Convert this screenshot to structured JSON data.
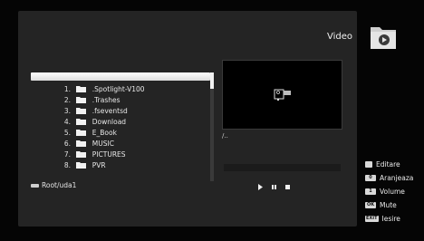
{
  "header": {
    "title": "Video",
    "icon": "video-folder-icon"
  },
  "file_list": {
    "items": [
      {
        "num": "1.",
        "name": ".Spotlight-V100"
      },
      {
        "num": "2.",
        "name": ".Trashes"
      },
      {
        "num": "3.",
        "name": ".fseventsd"
      },
      {
        "num": "4.",
        "name": "Download"
      },
      {
        "num": "5.",
        "name": "E_Book"
      },
      {
        "num": "6.",
        "name": "MUSIC"
      },
      {
        "num": "7.",
        "name": "PICTURES"
      },
      {
        "num": "8.",
        "name": "PVR"
      }
    ]
  },
  "path": {
    "label": "Root/uda1"
  },
  "preview": {
    "current_dir": "/..",
    "icon": "video-camera-icon"
  },
  "playback": {
    "progress": 0
  },
  "help": [
    {
      "key": "",
      "label": "Editare"
    },
    {
      "key": "0",
      "label": "Aranjeaza"
    },
    {
      "key": "1",
      "label": "Volume"
    },
    {
      "key": "OK",
      "label": "Mute"
    },
    {
      "key": "EXIT",
      "label": "Iesire"
    }
  ]
}
